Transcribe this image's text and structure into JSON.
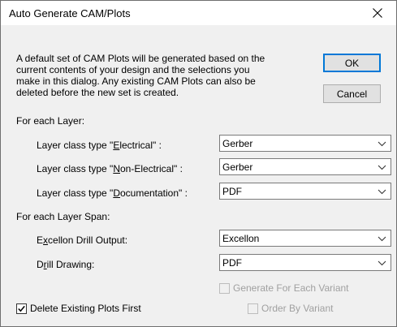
{
  "window": {
    "title": "Auto Generate CAM/Plots"
  },
  "description": [
    "A default set of CAM Plots will be generated based on the",
    "current contents of your design and the selections you",
    "make in this dialog. Any existing CAM Plots can also be",
    "deleted before the new set is created."
  ],
  "buttons": {
    "ok": "OK",
    "cancel": "Cancel"
  },
  "layer_section": {
    "heading": "For each Layer:",
    "rows": [
      {
        "label_pre": "Layer class type \"",
        "label_key": "E",
        "label_post": "lectrical\" :",
        "value": "Gerber"
      },
      {
        "label_pre": "Layer class type \"",
        "label_key": "N",
        "label_post": "on-Electrical\" :",
        "value": "Gerber"
      },
      {
        "label_pre": "Layer class type \"",
        "label_key": "D",
        "label_post": "ocumentation\" :",
        "value": "PDF"
      }
    ]
  },
  "span_section": {
    "heading": "For each Layer Span:",
    "rows": [
      {
        "label_pre": "E",
        "label_key": "x",
        "label_post": "cellon Drill Output:",
        "value": "Excellon"
      },
      {
        "label_pre": "D",
        "label_key": "r",
        "label_post": "ill Drawing:",
        "value": "PDF"
      }
    ]
  },
  "checkboxes": {
    "generate_variant": {
      "label": "Generate For Each Variant",
      "checked": false,
      "enabled": false
    },
    "delete_existing": {
      "label": "Delete Existing Plots First",
      "checked": true,
      "enabled": true
    },
    "order_variant": {
      "label": "Order By Variant",
      "checked": false,
      "enabled": false
    }
  },
  "icons": {
    "close": "close-icon",
    "dropdown": "chevron-down-icon",
    "check": "checkmark-icon"
  }
}
